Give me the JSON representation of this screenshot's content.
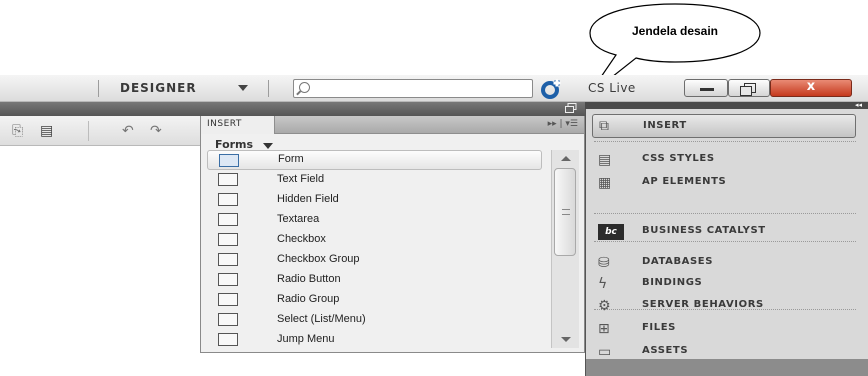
{
  "callout": {
    "text": "Jendela desain"
  },
  "appbar": {
    "workspace_label": "DESIGNER",
    "search_placeholder": "",
    "cslive_label": "CS Live",
    "close_glyph": "x",
    "icons": [
      "chevron-down-icon",
      "search-icon",
      "cslive-icon",
      "minimize-icon",
      "maximize-icon",
      "close-icon"
    ]
  },
  "darkstrip": {
    "collapse_glyph": "◂◂"
  },
  "insert_panel": {
    "tab": "INSERT",
    "tab_icons": "▸▸ | ▾☰",
    "category": "Forms",
    "items": [
      {
        "label": "Form",
        "icon": "form-icon"
      },
      {
        "label": "Text Field",
        "icon": "text-field-icon"
      },
      {
        "label": "Hidden Field",
        "icon": "hidden-field-icon"
      },
      {
        "label": "Textarea",
        "icon": "textarea-icon"
      },
      {
        "label": "Checkbox",
        "icon": "checkbox-icon"
      },
      {
        "label": "Checkbox Group",
        "icon": "checkbox-group-icon"
      },
      {
        "label": "Radio Button",
        "icon": "radio-button-icon"
      },
      {
        "label": "Radio Group",
        "icon": "radio-group-icon"
      },
      {
        "label": "Select (List/Menu)",
        "icon": "select-icon"
      },
      {
        "label": "Jump Menu",
        "icon": "jump-menu-icon"
      }
    ],
    "selected_index": 0
  },
  "right_panels": [
    {
      "label": "INSERT",
      "icon": "insert-icon"
    },
    {
      "label": "CSS STYLES",
      "icon": "css-styles-icon"
    },
    {
      "label": "AP ELEMENTS",
      "icon": "ap-elements-icon"
    },
    {
      "label": "BUSINESS CATALYST",
      "icon": "business-catalyst-icon"
    },
    {
      "label": "DATABASES",
      "icon": "databases-icon"
    },
    {
      "label": "BINDINGS",
      "icon": "bindings-icon"
    },
    {
      "label": "SERVER BEHAVIORS",
      "icon": "server-behaviors-icon"
    },
    {
      "label": "FILES",
      "icon": "files-icon"
    },
    {
      "label": "ASSETS",
      "icon": "assets-icon"
    }
  ],
  "colors": {
    "close_button": "#c5391d",
    "panel_bg": "#d9d9d9",
    "dark_strip": "#555555",
    "selected_row": "#dde8f5"
  }
}
